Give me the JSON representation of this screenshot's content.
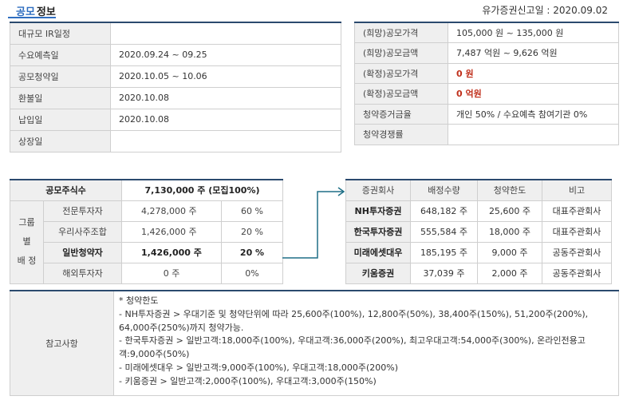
{
  "header": {
    "title_accent": "공모",
    "title_rest": "정보",
    "report_date_label": "유가증권신고일 : ",
    "report_date_value": "2020.09.02"
  },
  "schedule": [
    {
      "label": "대규모 IR일정",
      "value": ""
    },
    {
      "label": "수요예측일",
      "value": "2020.09.24 ~ 09.25"
    },
    {
      "label": "공모청약일",
      "value": "2020.10.05 ~ 10.06"
    },
    {
      "label": "환불일",
      "value": "2020.10.08"
    },
    {
      "label": "납입일",
      "value": "2020.10.08"
    },
    {
      "label": "상장일",
      "value": ""
    }
  ],
  "price": [
    {
      "label": "(희망)공모가격",
      "value": "105,000 원 ~ 135,000 원"
    },
    {
      "label": "(희망)공모금액",
      "value": "7,487 억원  ~ 9,626 억원"
    },
    {
      "label": "(확정)공모가격",
      "value": "0 원"
    },
    {
      "label": "(확정)공모금액",
      "value": "0 억원"
    },
    {
      "label": "청약증거금율",
      "value": "개인 50% / 수요예측 참여기관 0%"
    },
    {
      "label": "청약경쟁률",
      "value": ""
    }
  ],
  "allocation": {
    "total_label": "공모주식수",
    "total_value": "7,130,000 주 (모집100%)",
    "group_label_1": "그룹별",
    "group_label_2": "배 정",
    "rows": [
      {
        "category": "전문투자자",
        "shares": "4,278,000 주",
        "pct": "60 %"
      },
      {
        "category": "우리사주조합",
        "shares": "1,426,000 주",
        "pct": "20 %"
      },
      {
        "category": "일반청약자",
        "shares": "1,426,000 주",
        "pct": "20 %"
      },
      {
        "category": "해외투자자",
        "shares": "0 주",
        "pct": "0%"
      }
    ]
  },
  "underwriters": {
    "columns": [
      "증권회사",
      "배정수량",
      "청약한도",
      "비고"
    ],
    "rows": [
      {
        "firm": "NH투자증권",
        "qty": "648,182 주",
        "limit": "25,600 주",
        "note": "대표주관회사"
      },
      {
        "firm": "한국투자증권",
        "qty": "555,584 주",
        "limit": "18,000 주",
        "note": "대표주관회사"
      },
      {
        "firm": "미래에셋대우",
        "qty": "185,195 주",
        "limit": "9,000 주",
        "note": "공동주관회사"
      },
      {
        "firm": "키움증권",
        "qty": "37,039 주",
        "limit": "2,000 주",
        "note": "공동주관회사"
      }
    ]
  },
  "notes": {
    "label": "참고사항",
    "lines": [
      "* 청약한도",
      "- NH투자증권 > 우대기준 및 청약단위에 따라 25,600주(100%), 12,800주(50%), 38,400주(150%), 51,200주(200%), 64,000주(250%)까지 청약가능.",
      "- 한국투자증권 > 일반고객:18,000주(100%), 우대고객:36,000주(200%), 최고우대고객:54,000주(300%), 온라인전용고객:9,000주(50%)",
      "- 미래에셋대우 > 일반고객:9,000주(100%), 우대고객:18,000주(200%)",
      "- 키움증권 > 일반고객:2,000주(100%), 우대고객:3,000주(150%)"
    ]
  },
  "colors": {
    "accent": "#2f6ec0",
    "header_rule": "#2b4a6e",
    "label_bg": "#efefef",
    "confirmed_red": "#c0301c",
    "connector": "#1e6f86"
  }
}
